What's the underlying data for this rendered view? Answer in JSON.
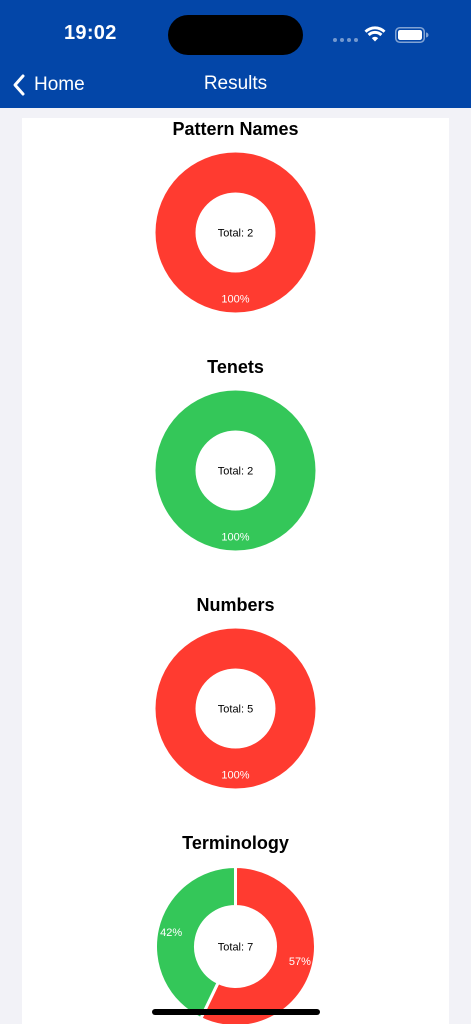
{
  "status_bar": {
    "time": "19:02"
  },
  "nav": {
    "back_label": "Home",
    "title": "Results"
  },
  "colors": {
    "header": "#0346a8",
    "red": "#ff3b30",
    "green": "#34c759"
  },
  "charts": [
    {
      "title": "Pattern Names",
      "center_label": "Total: 2",
      "slices": [
        {
          "color": "#ff3b30",
          "percent": 100,
          "label": "100%"
        }
      ]
    },
    {
      "title": "Tenets",
      "center_label": "Total: 2",
      "slices": [
        {
          "color": "#34c759",
          "percent": 100,
          "label": "100%"
        }
      ]
    },
    {
      "title": "Numbers",
      "center_label": "Total: 5",
      "slices": [
        {
          "color": "#ff3b30",
          "percent": 100,
          "label": "100%"
        }
      ]
    },
    {
      "title": "Terminology",
      "center_label": "Total: 7",
      "slices": [
        {
          "color": "#ff3b30",
          "percent": 57.14,
          "label": "57%"
        },
        {
          "color": "#34c759",
          "percent": 42.86,
          "label": "42%"
        }
      ]
    }
  ]
}
